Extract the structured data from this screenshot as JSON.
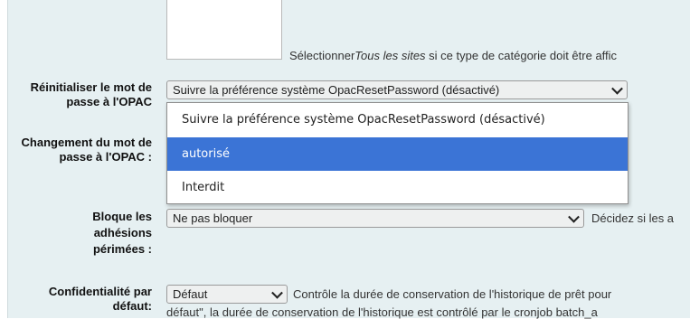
{
  "top_hint": {
    "prefix": "Sélectionner",
    "italic": "Tous les sites",
    "suffix": " si ce type de catégorie doit être affic"
  },
  "reset_password": {
    "label": "Réinitialiser le mot de passe à l'OPAC",
    "selected": "Suivre la préférence système OpacResetPassword (désactivé)",
    "options": [
      "Suivre la préférence système OpacResetPassword (désactivé)",
      "autorisé",
      "Interdit"
    ],
    "highlighted_option": "autorisé"
  },
  "change_password": {
    "label": "Changement du mot de passe à l'OPAC :"
  },
  "block_expired": {
    "label": "Bloque les adhésions périmées :",
    "selected": "Ne pas bloquer",
    "hint": "Décidez si les a"
  },
  "privacy": {
    "label": "Confidentialité par défaut:",
    "selected": "Défaut",
    "hint": "Contrôle la durée de conservation de l'historique de prêt pour",
    "hint_line2": "défaut\", la durée de conservation de l'historique est contrôlé par le cronjob batch_a"
  },
  "colors": {
    "panel_background": "#e6f0f2",
    "highlight": "#3b74d6"
  },
  "icons": {
    "select_arrow": "chevron-down-icon"
  }
}
